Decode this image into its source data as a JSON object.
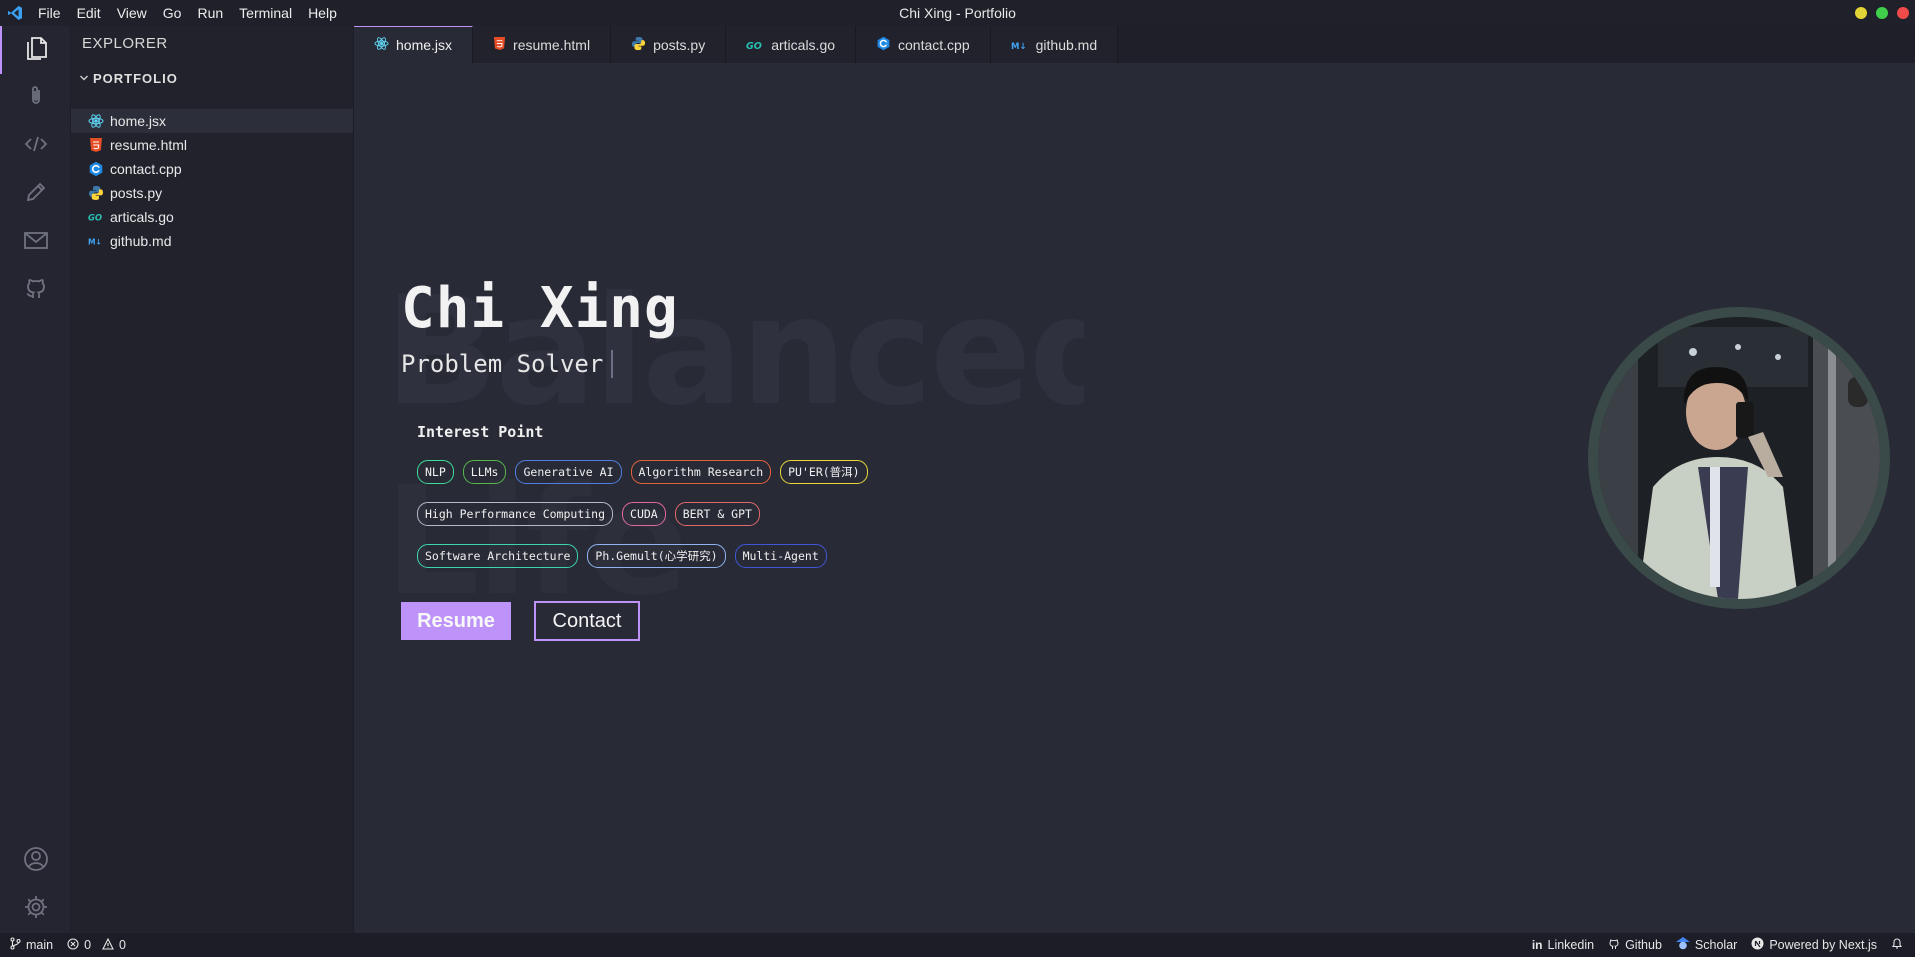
{
  "window": {
    "title": "Chi Xing - Portfolio"
  },
  "menu": [
    "File",
    "Edit",
    "View",
    "Go",
    "Run",
    "Terminal",
    "Help"
  ],
  "explorer": {
    "title": "EXPLORER",
    "folder": "PORTFOLIO",
    "files": [
      {
        "name": "home.jsx",
        "icon": "react-icon"
      },
      {
        "name": "resume.html",
        "icon": "html-icon"
      },
      {
        "name": "contact.cpp",
        "icon": "cpp-icon"
      },
      {
        "name": "posts.py",
        "icon": "python-icon"
      },
      {
        "name": "articals.go",
        "icon": "go-icon"
      },
      {
        "name": "github.md",
        "icon": "markdown-icon"
      }
    ]
  },
  "tabs": [
    {
      "label": "home.jsx",
      "icon": "react-icon"
    },
    {
      "label": "resume.html",
      "icon": "html-icon"
    },
    {
      "label": "posts.py",
      "icon": "python-icon"
    },
    {
      "label": "articals.go",
      "icon": "go-icon"
    },
    {
      "label": "contact.cpp",
      "icon": "cpp-icon"
    },
    {
      "label": "github.md",
      "icon": "markdown-icon"
    }
  ],
  "hero": {
    "name": "Chi Xing",
    "role": "Problem Solver",
    "interest_title": "Interest Point",
    "tags": [
      {
        "label": "NLP",
        "color": "#3ddc97"
      },
      {
        "label": "LLMs",
        "color": "#55b94a"
      },
      {
        "label": "Generative AI",
        "color": "#4f7fe0"
      },
      {
        "label": "Algorithm Research",
        "color": "#e0623b"
      },
      {
        "label": "PU'ER(普洱)",
        "color": "#e8d83a"
      },
      {
        "label": "High Performance Computing",
        "color": "#b8b8c8"
      },
      {
        "label": "CUDA",
        "color": "#e06aa0"
      },
      {
        "label": "BERT & GPT",
        "color": "#e06a6a"
      },
      {
        "label": "Software Architecture",
        "color": "#3dd6a8"
      },
      {
        "label": "Ph.Gemult(心学研究)",
        "color": "#8fb4f0"
      },
      {
        "label": "Multi-Agent",
        "color": "#3f56d6"
      }
    ],
    "resume_button": "Resume",
    "contact_button": "Contact"
  },
  "status": {
    "branch": "main",
    "errors": "0",
    "warnings": "0",
    "links": [
      "Linkedin",
      "Github",
      "Scholar",
      "Powered by Next.js"
    ]
  },
  "colors": {
    "accent": "#bd93f9",
    "background": "#282a36"
  }
}
